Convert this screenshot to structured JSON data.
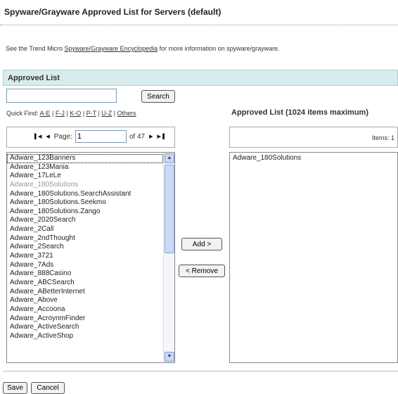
{
  "page": {
    "title": "Spyware/Grayware Approved List for Servers (default)",
    "info_prefix": "See the Trend Micro ",
    "info_link": "Spyware/Grayware Encyclopedia",
    "info_suffix": " for more information on spyware/grayware."
  },
  "section": {
    "header": "Approved List"
  },
  "search": {
    "value": "",
    "button_label": "Search"
  },
  "quick_find": {
    "label": "Quick Find: ",
    "links": [
      "A-E",
      "F-J",
      "K-O",
      "P-T",
      "U-Z",
      "Others"
    ],
    "separator": " | "
  },
  "pager": {
    "first_icon": "first-page-icon",
    "prev_icon": "previous-page-icon",
    "next_icon": "next-page-icon",
    "last_icon": "last-page-icon",
    "page_label": "Page:",
    "page_value": "1",
    "of_label": "of 47"
  },
  "available_list": {
    "items": [
      "Adware_123Banners",
      "Adware_123Mania",
      "Adware_17LeLe",
      "Adware_180Solutions",
      "Adware_180Solutions.SearchAssistant",
      "Adware_180Solutions.Seekmo",
      "Adware_180Solutions.Zango",
      "Adware_2020Search",
      "Adware_2Call",
      "Adware_2ndThought",
      "Adware_2Search",
      "Adware_3721",
      "Adware_7Ads",
      "Adware_888Casino",
      "Adware_ABCSearch",
      "Adware_ABetterInternet",
      "Adware_Above",
      "Adware_Accoona",
      "Adware_AcroynmFinder",
      "Adware_ActiveSearch",
      "Adware_ActiveShop"
    ],
    "focused_index": 0,
    "disabled_index": 3
  },
  "transfer": {
    "add_label": "Add >",
    "remove_label": "< Remove"
  },
  "approved": {
    "title": "Approved List (1024 items maximum)",
    "items_count": "Items: 1",
    "items": [
      "Adware_180Solutions"
    ]
  },
  "footer": {
    "save_label": "Save",
    "cancel_label": "Cancel"
  },
  "colors": {
    "section_header_bg": "#d9ecec",
    "scrollbar_thumb": "#c9d9f6",
    "dim_text": "#999999"
  }
}
